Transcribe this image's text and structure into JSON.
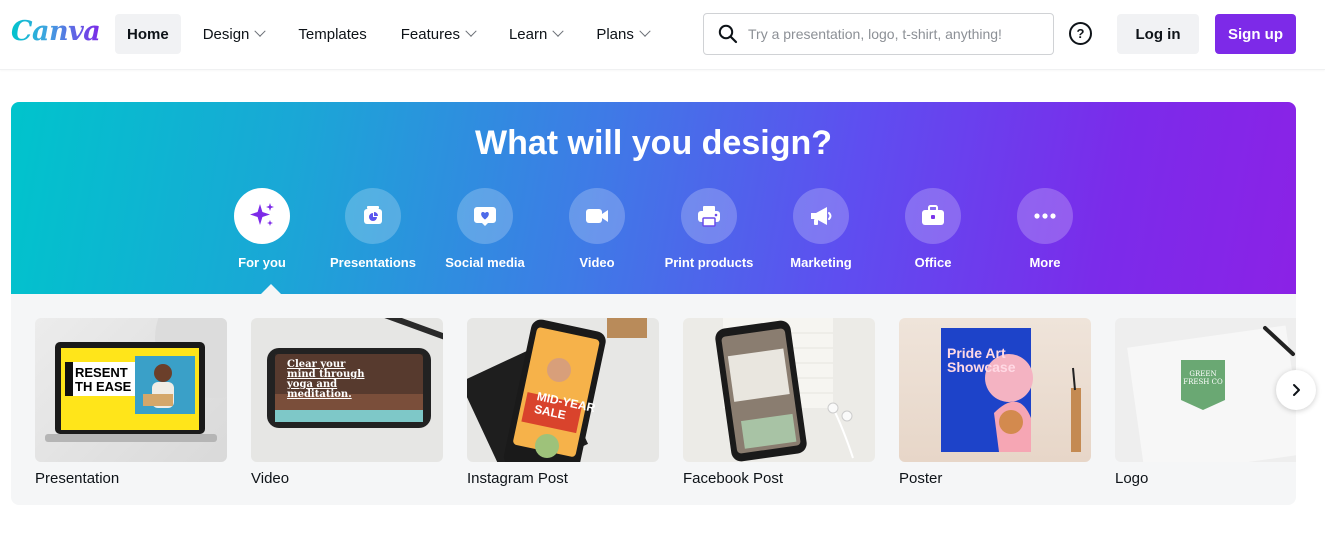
{
  "brand": {
    "logo_text": "Canva"
  },
  "nav": {
    "items": [
      {
        "label": "Home",
        "active": true,
        "has_dropdown": false
      },
      {
        "label": "Design",
        "active": false,
        "has_dropdown": true
      },
      {
        "label": "Templates",
        "active": false,
        "has_dropdown": false
      },
      {
        "label": "Features",
        "active": false,
        "has_dropdown": true
      },
      {
        "label": "Learn",
        "active": false,
        "has_dropdown": true
      },
      {
        "label": "Plans",
        "active": false,
        "has_dropdown": true
      }
    ]
  },
  "search": {
    "placeholder": "Try a presentation, logo, t-shirt, anything!",
    "value": "",
    "icon": "search-icon"
  },
  "header_actions": {
    "help_icon": "help-icon",
    "help_glyph": "?",
    "login_label": "Log in",
    "signup_label": "Sign up"
  },
  "hero": {
    "title": "What will you design?",
    "categories": [
      {
        "label": "For you",
        "icon": "sparkles-icon",
        "active": true
      },
      {
        "label": "Presentations",
        "icon": "presentation-icon",
        "active": false
      },
      {
        "label": "Social media",
        "icon": "heart-icon",
        "active": false
      },
      {
        "label": "Video",
        "icon": "video-icon",
        "active": false
      },
      {
        "label": "Print products",
        "icon": "printer-icon",
        "active": false
      },
      {
        "label": "Marketing",
        "icon": "megaphone-icon",
        "active": false
      },
      {
        "label": "Office",
        "icon": "briefcase-icon",
        "active": false
      },
      {
        "label": "More",
        "icon": "more-icon",
        "active": false
      }
    ]
  },
  "cards": [
    {
      "label": "Presentation",
      "thumb_text": [
        "RESENT",
        "TH EASE"
      ]
    },
    {
      "label": "Video",
      "thumb_text": [
        "Clear your",
        "mind through",
        "yoga and",
        "meditation."
      ]
    },
    {
      "label": "Instagram Post",
      "thumb_text": [
        "MID-YEAR",
        "SALE"
      ]
    },
    {
      "label": "Facebook Post",
      "thumb_text": []
    },
    {
      "label": "Poster",
      "thumb_text": [
        "Pride Art",
        "Showcase"
      ]
    },
    {
      "label": "Logo",
      "thumb_text": [
        "GREEN",
        "FRESH CO"
      ]
    }
  ],
  "carousel": {
    "next_icon": "chevron-right-icon"
  },
  "colors": {
    "brand_purple": "#7d2ae8",
    "gradient_start": "#00c4cc",
    "gradient_end": "#8b22e6"
  }
}
